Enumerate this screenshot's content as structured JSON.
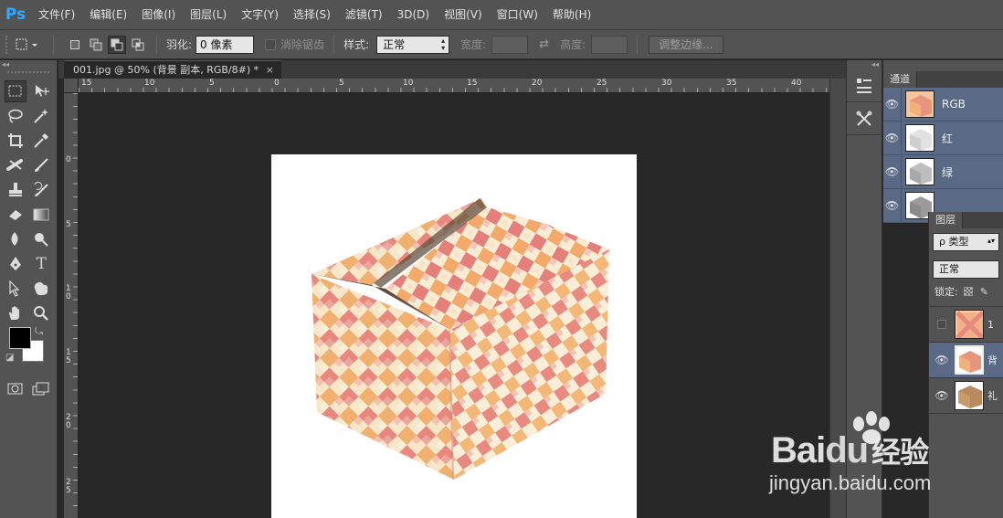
{
  "app": {
    "logo": "Ps"
  },
  "menu": [
    "文件(F)",
    "编辑(E)",
    "图像(I)",
    "图层(L)",
    "文字(Y)",
    "选择(S)",
    "滤镜(T)",
    "3D(D)",
    "视图(V)",
    "窗口(W)",
    "帮助(H)"
  ],
  "options": {
    "feather_label": "羽化:",
    "feather_value": "0 像素",
    "antialias_label": "消除锯齿",
    "style_label": "样式:",
    "style_value": "正常",
    "width_label": "宽度:",
    "height_label": "高度:",
    "refine_edge": "调整边缘..."
  },
  "toolbar": {
    "collapse": "◂◂",
    "tools": [
      [
        "rectangular-marquee",
        "move"
      ],
      [
        "lasso",
        "magic-wand"
      ],
      [
        "crop",
        "eyedropper"
      ],
      [
        "healing-brush",
        "brush"
      ],
      [
        "clone-stamp",
        "history-brush"
      ],
      [
        "eraser",
        "gradient"
      ],
      [
        "blur",
        "dodge"
      ],
      [
        "pen",
        "type"
      ],
      [
        "path-selection",
        "custom-shape"
      ],
      [
        "hand",
        "zoom"
      ]
    ],
    "foreground_color": "#000000",
    "background_color": "#ffffff"
  },
  "document": {
    "tab_title": "001.jpg @ 50% (背景 副本, RGB/8#) *",
    "tab_close": "×",
    "ruler_top": [
      "15",
      "10",
      "5",
      "0",
      "5",
      "10",
      "15",
      "20",
      "25",
      "30",
      "35",
      "40"
    ],
    "ruler_left": [
      "0",
      "5",
      "1\n0",
      "1\n5",
      "2\n0",
      "2\n5"
    ]
  },
  "dock": {
    "collapse": "◂◂"
  },
  "channels": {
    "tab": "通道",
    "rows": [
      {
        "label": "RGB"
      },
      {
        "label": "红"
      },
      {
        "label": "绿"
      },
      {
        "label": ""
      }
    ]
  },
  "layers": {
    "tab": "图层",
    "filter_label": "ρ 类型",
    "blend_mode": "正常",
    "lock_label": "锁定:",
    "rows": [
      {
        "name": "1"
      },
      {
        "name": "背"
      },
      {
        "name": "礼"
      }
    ]
  },
  "watermark": {
    "brand": "Bai",
    "brand2": "du",
    "cn": "经验",
    "url": "jingyan.baidu.com"
  },
  "colors": {
    "accent": "#31a8ff",
    "selection": "#5a6a86"
  }
}
